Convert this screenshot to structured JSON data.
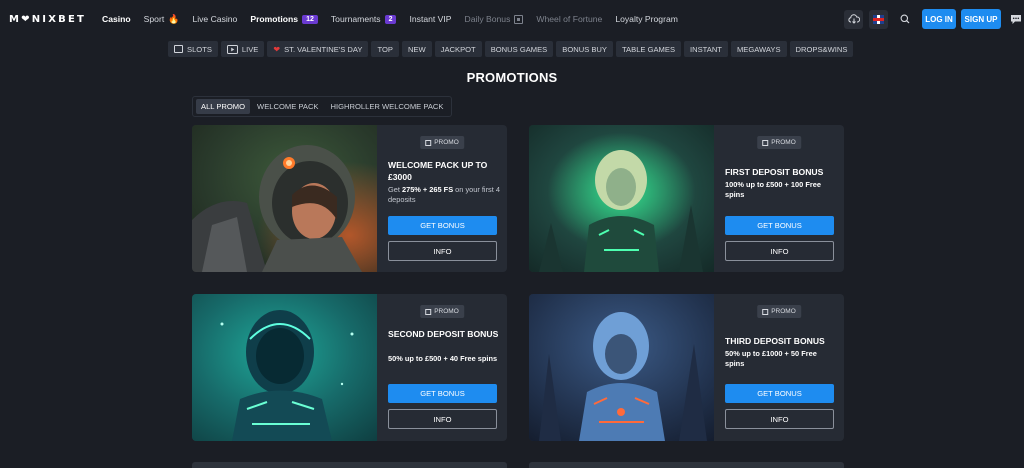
{
  "header": {
    "logo": "M❤NIXBET",
    "nav": [
      {
        "label": "Casino",
        "style": "bold"
      },
      {
        "label": "Sport",
        "icon": "fire-icon"
      },
      {
        "label": "Live Casino"
      },
      {
        "label": "Promotions",
        "style": "bold",
        "badge": "12"
      },
      {
        "label": "Tournaments",
        "badge": "2"
      },
      {
        "label": "Instant VIP"
      },
      {
        "label": "Daily Bonus",
        "style": "dim",
        "icon": "calendar-icon"
      },
      {
        "label": "Wheel of Fortune",
        "style": "dim"
      },
      {
        "label": "Loyalty Program"
      }
    ],
    "login_label": "LOG IN",
    "signup_label": "SIGN UP"
  },
  "categories": [
    {
      "label": "SLOTS",
      "icon": "slots-icon"
    },
    {
      "label": "LIVE",
      "icon": "live-icon"
    },
    {
      "label": "ST. VALENTINE'S DAY",
      "icon": "heart-icon"
    },
    {
      "label": "TOP"
    },
    {
      "label": "NEW"
    },
    {
      "label": "JACKPOT"
    },
    {
      "label": "BONUS GAMES"
    },
    {
      "label": "BONUS BUY"
    },
    {
      "label": "TABLE GAMES"
    },
    {
      "label": "INSTANT"
    },
    {
      "label": "MEGAWAYS"
    },
    {
      "label": "DROPS&WINS"
    }
  ],
  "page_title": "PROMOTIONS",
  "tabs": [
    {
      "label": "ALL PROMO",
      "active": true
    },
    {
      "label": "WELCOME PACK"
    },
    {
      "label": "HIGHROLLER WELCOME PACK"
    }
  ],
  "promo_badge": "PROMO",
  "promos": [
    {
      "title": "WELCOME PACK UP TO £3000",
      "desc_lead": "Get ",
      "desc_bold": "275% + 265 FS",
      "desc_tail": " on your first 4 deposits",
      "get_label": "GET BONUS",
      "info_label": "INFO"
    },
    {
      "title": "FIRST DEPOSIT BONUS",
      "desc_lead": "",
      "desc_bold": "100% up to £500 + 100 Free spins",
      "desc_tail": "",
      "get_label": "GET BONUS",
      "info_label": "INFO"
    },
    {
      "title": "SECOND DEPOSIT BONUS",
      "desc_lead": "",
      "desc_bold": "50% up to £500 + 40 Free spins",
      "desc_tail": "",
      "get_label": "GET BONUS",
      "info_label": "INFO"
    },
    {
      "title": "THIRD DEPOSIT BONUS",
      "desc_lead": "",
      "desc_bold": "50% up to £1000 + 50 Free spins",
      "desc_tail": "",
      "get_label": "GET BONUS",
      "info_label": "INFO"
    }
  ],
  "colors": {
    "accent": "#1e8cf0",
    "badge": "#6a3ad1",
    "background": "#1b1e25",
    "card": "#262b34"
  }
}
